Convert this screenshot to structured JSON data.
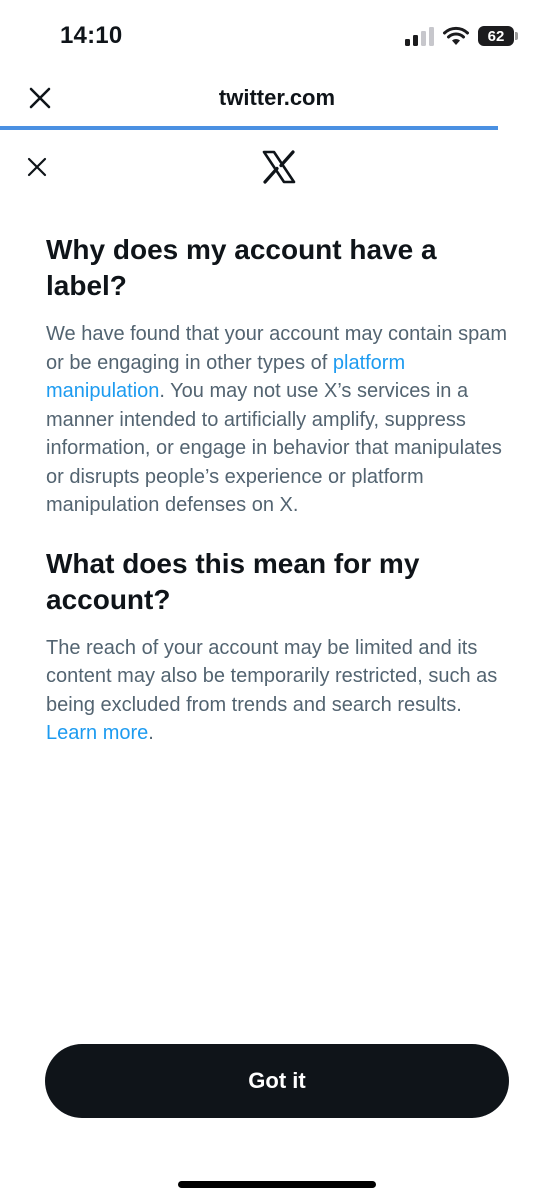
{
  "status_bar": {
    "time": "14:10",
    "battery": "62",
    "icons": [
      "signal-icon",
      "wifi-icon",
      "battery-icon"
    ]
  },
  "browser": {
    "url": "twitter.com",
    "close_icon": "close-icon",
    "progress_color": "#4a90e2"
  },
  "page_header": {
    "close_icon": "close-icon",
    "logo_icon": "x-logo-icon"
  },
  "sections": [
    {
      "heading": "Why does my account have a label?",
      "text_before": "We have found that your account may contain spam or be engaging in other types of ",
      "link": "platform manipulation",
      "text_after": ". You may not use X’s services in a manner intended to artificially amplify, suppress information, or engage in behavior that manipulates or disrupts people’s experience or platform manipulation defenses on X."
    },
    {
      "heading": "What does this mean for my account?",
      "text_before": "The reach of your account may be limited and its content may also be temporarily restricted, such as being excluded from trends and search results. ",
      "link": "Learn more",
      "text_after": "."
    }
  ],
  "button": {
    "label": "Got it"
  },
  "colors": {
    "text_primary": "#0f1419",
    "text_secondary": "#536471",
    "link": "#1d9bf0",
    "button_bg": "#0f1419"
  }
}
